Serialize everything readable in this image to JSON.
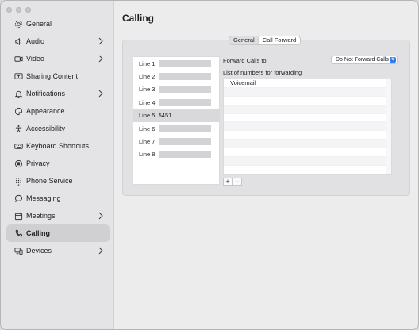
{
  "window": {
    "title": "Calling"
  },
  "sidebar": {
    "items": [
      {
        "label": "General",
        "icon": "gear-icon",
        "has_chevron": false
      },
      {
        "label": "Audio",
        "icon": "speaker-icon",
        "has_chevron": true
      },
      {
        "label": "Video",
        "icon": "video-camera-icon",
        "has_chevron": true
      },
      {
        "label": "Sharing Content",
        "icon": "screen-share-icon",
        "has_chevron": false
      },
      {
        "label": "Notifications",
        "icon": "bell-icon",
        "has_chevron": true
      },
      {
        "label": "Appearance",
        "icon": "palette-icon",
        "has_chevron": false
      },
      {
        "label": "Accessibility",
        "icon": "accessibility-icon",
        "has_chevron": false
      },
      {
        "label": "Keyboard Shortcuts",
        "icon": "keyboard-icon",
        "has_chevron": false
      },
      {
        "label": "Privacy",
        "icon": "privacy-icon",
        "has_chevron": false
      },
      {
        "label": "Phone Service",
        "icon": "dialpad-icon",
        "has_chevron": false
      },
      {
        "label": "Messaging",
        "icon": "chat-bubble-icon",
        "has_chevron": false
      },
      {
        "label": "Meetings",
        "icon": "calendar-icon",
        "has_chevron": true
      },
      {
        "label": "Calling",
        "icon": "phone-icon",
        "has_chevron": false,
        "active": true
      },
      {
        "label": "Devices",
        "icon": "devices-icon",
        "has_chevron": true
      }
    ]
  },
  "tabs": {
    "general": "General",
    "call_forward": "Call Forward",
    "selected": "Call Forward"
  },
  "lines": [
    {
      "label": "Line 1:",
      "redacted": true
    },
    {
      "label": "Line 2:",
      "redacted": true
    },
    {
      "label": "Line 3:",
      "redacted": true
    },
    {
      "label": "Line 4:",
      "redacted": true
    },
    {
      "label": "Line 5: 5451",
      "redacted": false,
      "selected": true
    },
    {
      "label": "Line 6:",
      "redacted": true
    },
    {
      "label": "Line 7:",
      "redacted": true
    },
    {
      "label": "Line 8:",
      "redacted": true
    }
  ],
  "forward": {
    "label": "Forward Calls to:",
    "dropdown_value": "Do Not Forward Calls",
    "list_label": "List of numbers for forwarding",
    "numbers": [
      "Voicemail",
      "",
      "",
      "",
      "",
      "",
      "",
      "",
      "",
      "",
      ""
    ],
    "add_label": "+",
    "remove_label": "−"
  }
}
